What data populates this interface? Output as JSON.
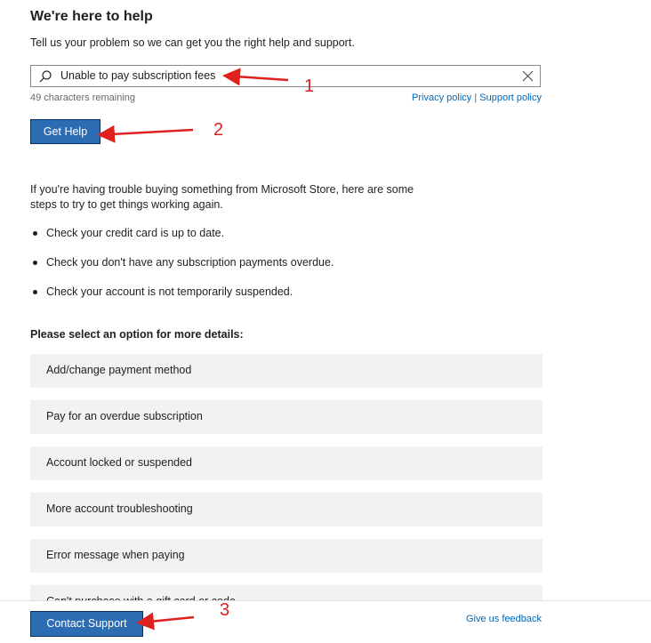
{
  "header": {
    "title": "We're here to help",
    "intro": "Tell us your problem so we can get you the right help and support."
  },
  "search": {
    "value": "Unable to pay subscription fees",
    "chars_remaining": "49 characters remaining"
  },
  "policy": {
    "privacy_label": "Privacy policy",
    "separator": " | ",
    "support_label": "Support policy"
  },
  "buttons": {
    "get_help": "Get Help",
    "contact_support": "Contact Support"
  },
  "info": {
    "text": "If you're having trouble buying something from Microsoft Store, here are some steps to try to get things working again.",
    "steps": [
      "Check your credit card is up to date.",
      "Check you don't have any subscription payments overdue.",
      "Check your account is not temporarily suspended."
    ]
  },
  "options": {
    "heading": "Please select an option for more details:",
    "items": [
      "Add/change payment method",
      "Pay for an overdue subscription",
      "Account locked or suspended",
      "More account troubleshooting",
      "Error message when paying",
      "Can't purchase with a gift card or code"
    ]
  },
  "footer": {
    "feedback_label": "Give us feedback"
  },
  "annotations": {
    "labels": [
      "1",
      "2",
      "3"
    ],
    "color": "#e0201c"
  },
  "colors": {
    "button_blue": "#2b6cb3",
    "link_blue": "#0067b8",
    "option_bg": "#f2f2f2"
  }
}
